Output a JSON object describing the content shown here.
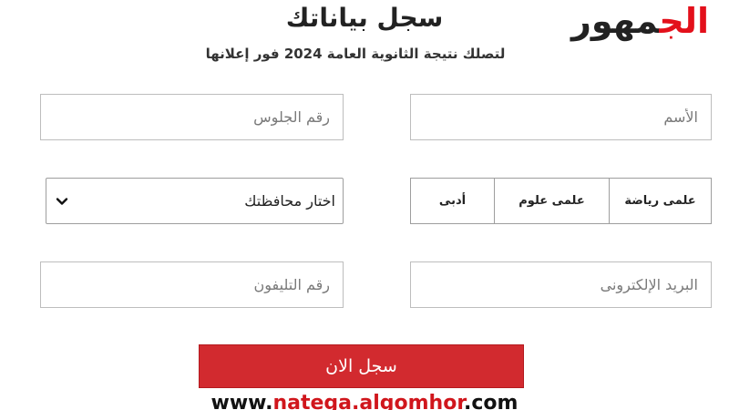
{
  "brand": {
    "logo_red": "الج",
    "logo_dark": "مهور"
  },
  "header": {
    "title": "سجل بياناتك",
    "subtitle": "لتصلك نتيجة الثانوية العامة 2024 فور إعلانها"
  },
  "form": {
    "name_placeholder": "الأسم",
    "seat_number_placeholder": "رقم الجلوس",
    "tracks": [
      {
        "label": "علمى رياضة"
      },
      {
        "label": "علمى علوم"
      },
      {
        "label": "أدبى"
      }
    ],
    "governorate_select": {
      "selected": "اختار محافظتك"
    },
    "email_placeholder": "البريد الإلكترونى",
    "phone_placeholder": "رقم التليفون",
    "submit_label": "سجل الان"
  },
  "footer": {
    "url_prefix": "www.",
    "url_domain": "natega.algomhor",
    "url_suffix": ".com"
  },
  "colors": {
    "accent_red": "#d22a2f",
    "logo_red": "#e3101b",
    "text_dark": "#222222",
    "border_gray": "#bdbdbd"
  },
  "icons": {
    "select_arrow": "chevron-down-icon"
  }
}
